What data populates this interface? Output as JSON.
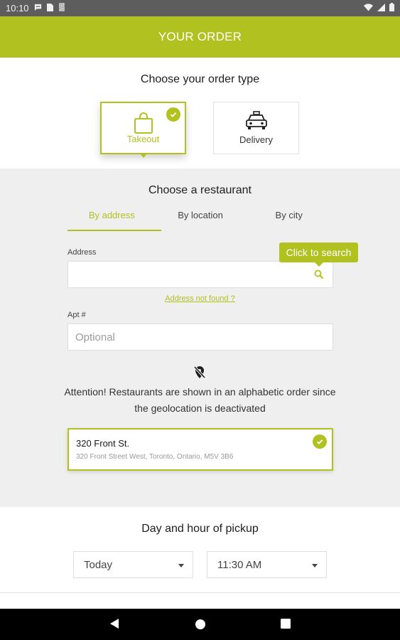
{
  "status_bar": {
    "time": "10:10",
    "left_icons": [
      "chat-bubble-icon",
      "sim-card-icon",
      "sync-icon"
    ],
    "right_icons": [
      "wifi-icon",
      "signal-icon",
      "battery-icon"
    ]
  },
  "header": {
    "title": "YOUR ORDER"
  },
  "order_type": {
    "title": "Choose your order type",
    "options": [
      {
        "label": "Takeout",
        "icon": "shopping-bag-icon",
        "selected": true
      },
      {
        "label": "Delivery",
        "icon": "taxi-icon",
        "selected": false
      }
    ]
  },
  "restaurant": {
    "title": "Choose a restaurant",
    "tabs": [
      {
        "label": "By address",
        "active": true
      },
      {
        "label": "By location",
        "active": false
      },
      {
        "label": "By city",
        "active": false
      }
    ],
    "address_label": "Address",
    "address_value": "",
    "search_tooltip": "Click to search",
    "address_not_found": "Address not found ?",
    "apt_label": "Apt #",
    "apt_placeholder": "Optional",
    "attention": "Attention! Restaurants are shown in an alphabetic order since the geolocation is deactivated",
    "selected_restaurant": {
      "name": "320 Front St.",
      "address": "320 Front Street West, Toronto, Ontario, M5V 3B6"
    }
  },
  "pickup": {
    "title": "Day and hour of pickup",
    "day": "Today",
    "time": "11:30 AM"
  },
  "colors": {
    "accent": "#b1c11f",
    "section_gray": "#efefef"
  }
}
